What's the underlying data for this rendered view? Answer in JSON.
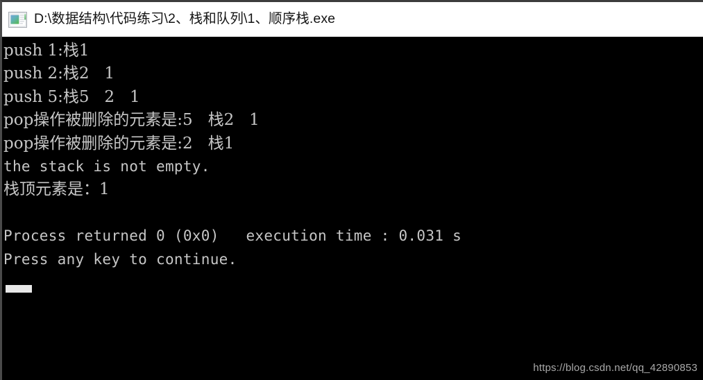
{
  "window": {
    "title": "D:\\数据结构\\代码练习\\2、栈和队列\\1、顺序栈.exe",
    "icon": "console-app-icon",
    "title_bar_background": "#ffffff",
    "title_text_color": "#141414"
  },
  "console": {
    "background": "#000000",
    "text_color": "#c6c6c6",
    "cursor": "block-cursor",
    "lines": [
      {
        "text": "push 1:栈1",
        "mono": false
      },
      {
        "text": "push 2:栈2   1",
        "mono": false
      },
      {
        "text": "push 5:栈5   2   1",
        "mono": false
      },
      {
        "text": "pop操作被删除的元素是:5   栈2   1",
        "mono": false
      },
      {
        "text": "pop操作被删除的元素是:2   栈1",
        "mono": false
      },
      {
        "text": "the stack is not empty.",
        "mono": true
      },
      {
        "text": "栈顶元素是：1",
        "mono": false
      },
      {
        "text": "",
        "mono": false
      },
      {
        "text": "Process returned 0 (0x0)   execution time : 0.031 s",
        "mono": true
      },
      {
        "text": "Press any key to continue.",
        "mono": true
      }
    ]
  },
  "watermark": {
    "text": "https://blog.csdn.net/qq_42890853",
    "color": "#a9a9a9"
  }
}
